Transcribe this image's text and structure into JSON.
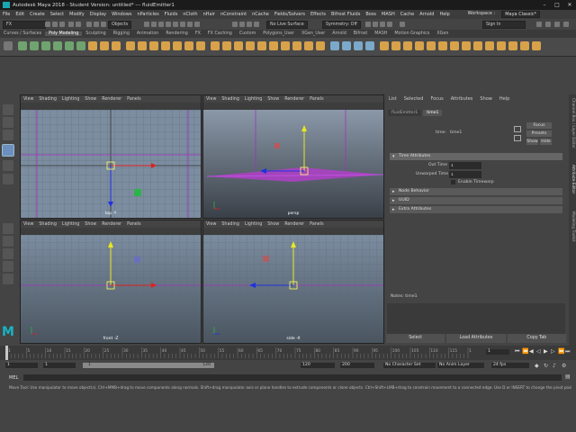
{
  "title_bar": {
    "title": "Autodesk Maya 2018 - Student Version: untitled*  ---  fluidEmitter1"
  },
  "menu": [
    "File",
    "Edit",
    "Create",
    "Select",
    "Modify",
    "Display",
    "Windows",
    "nParticles",
    "Fluids",
    "nCloth",
    "nHair",
    "nConstraint",
    "nCache",
    "Fields/Solvers",
    "Effects",
    "Bifrost Fluids",
    "Boss",
    "MASH",
    "Cache",
    "Arnold",
    "Help"
  ],
  "workspace": {
    "label": "Workspace :",
    "value": "Maya Classic*"
  },
  "status": {
    "mode_dropdown": "FX",
    "objects_label": "Objects",
    "no_live_surface": "No Live Surface",
    "symmetry": "Symmetry: Off",
    "sign_in": "Sign In"
  },
  "shelf_tabs": [
    "Curves / Surfaces",
    "Poly Modeling",
    "Sculpting",
    "Rigging",
    "Animation",
    "Rendering",
    "FX",
    "FX Caching",
    "Custom",
    "Polygons_User",
    "XGen_User",
    "Arnold",
    "Bifrost",
    "MASH",
    "Motion Graphics",
    "XGen"
  ],
  "shelf_active": "Poly Modeling",
  "viewport_menu": [
    "View",
    "Shading",
    "Lighting",
    "Show",
    "Renderer",
    "Panels"
  ],
  "viewports": [
    {
      "label": "top -Y"
    },
    {
      "label": "persp"
    },
    {
      "label": "front -Z"
    },
    {
      "label": "side -X"
    }
  ],
  "attr_menu": [
    "List",
    "Selected",
    "Focus",
    "Attributes",
    "Show",
    "Help"
  ],
  "attr_tabs": [
    "fluidEmitter1",
    "time1"
  ],
  "attr_active_tab": "time1",
  "attr": {
    "node_label": "time:",
    "node_value": "time1",
    "focus": "Focus",
    "presets": "Presets",
    "show": "Show",
    "hide": "Hide",
    "sections": [
      "Time Attributes",
      "Node Behavior",
      "UUID",
      "Extra Attributes"
    ],
    "out_time_label": "Out Time",
    "out_time_value": "1",
    "unwarped_label": "Unwarped Time",
    "unwarped_value": "1",
    "enable_timewarp": "Enable Timewarp",
    "notes_label": "Notes:  time1",
    "bottom_buttons": [
      "Select",
      "Load Attributes",
      "Copy Tab"
    ]
  },
  "side_tabs": [
    "Channel Box / Layer Editor",
    "Attribute Editor",
    "Modeling Toolkit"
  ],
  "timeline": {
    "ticks": [
      "1",
      "5",
      "10",
      "15",
      "20",
      "25",
      "30",
      "35",
      "40",
      "45",
      "50",
      "55",
      "60",
      "65",
      "70",
      "75",
      "80",
      "85",
      "90",
      "95",
      "100",
      "105",
      "110",
      "115",
      "1"
    ],
    "current": "1"
  },
  "range": {
    "start": "1",
    "start2": "1",
    "slider_left": "1",
    "slider_right": "120",
    "end1": "120",
    "end2": "200",
    "char_set": "No Character Set",
    "anim_layer": "No Anim Layer",
    "fps": "24 fps"
  },
  "cmd": {
    "label": "MEL"
  },
  "help_text": "Move Tool: Use manipulator to move object(s). Ctrl+MMB+drag to move components along normals. Shift+drag manipulator axis or plane handles to extrude components or clone objects. Ctrl+Shift+LMB+drag to constrain movement to a connected edge. Use D or INSERT to change the pivot position and axis orientation."
}
